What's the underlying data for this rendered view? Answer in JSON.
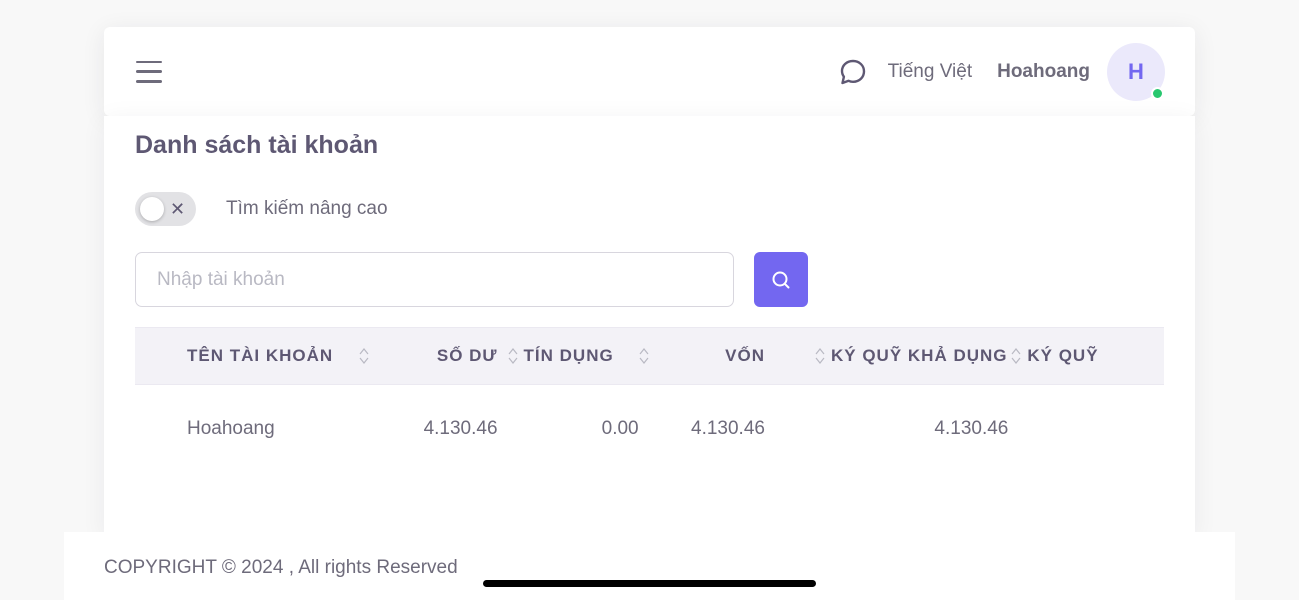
{
  "navbar": {
    "language": "Tiếng Việt",
    "username": "Hoahoang",
    "avatar_initial": "H",
    "icons": [
      "menu-icon",
      "chat-icon"
    ],
    "status_color": "#28c76f"
  },
  "page": {
    "title": "Danh sách tài khoản",
    "advanced_search_label": "Tìm kiếm nâng cao",
    "advanced_search_enabled": false,
    "search_placeholder": "Nhập tài khoản",
    "accent_color": "#7367f0"
  },
  "table": {
    "columns": [
      "TÊN TÀI KHOẢN",
      "SỐ DƯ",
      "TÍN DỤNG",
      "VỐN",
      "KÝ QUỸ KHẢ DỤNG",
      "KÝ QUỸ"
    ],
    "rows": [
      {
        "name": "Hoahoang",
        "balance": "4.130.46",
        "credit": "0.00",
        "equity": "4.130.46",
        "free_margin": "4.130.46"
      }
    ]
  },
  "footer": {
    "copyright": "COPYRIGHT © 2024 , All rights Reserved"
  }
}
